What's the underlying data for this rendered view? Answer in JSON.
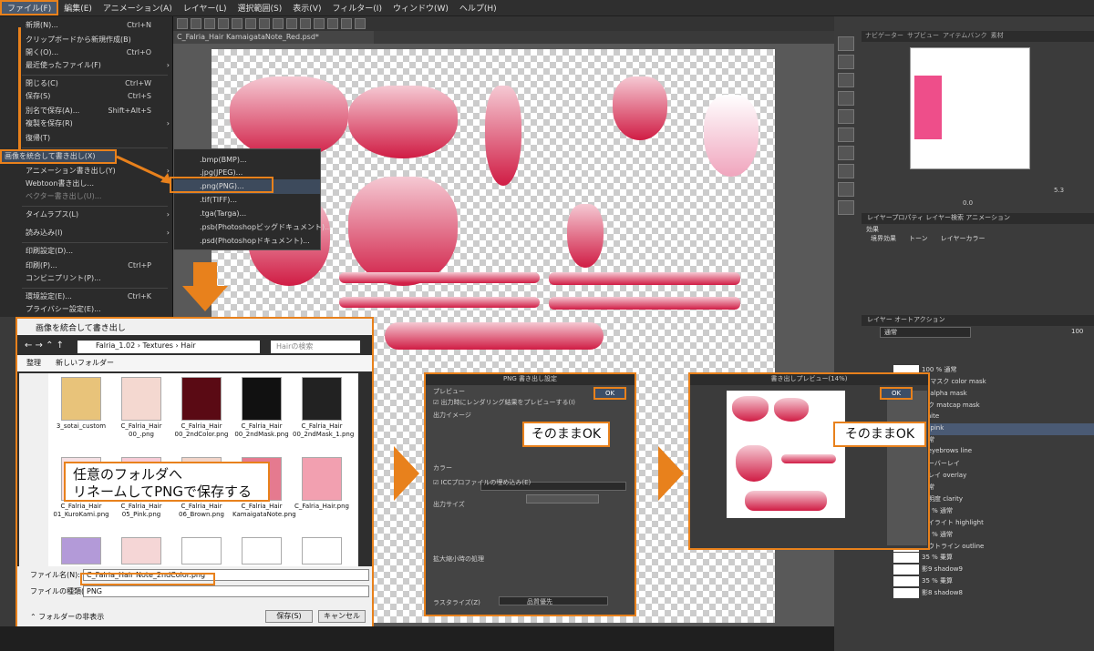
{
  "menubar": {
    "items": [
      "ファイル(F)",
      "編集(E)",
      "アニメーション(A)",
      "レイヤー(L)",
      "選択範囲(S)",
      "表示(V)",
      "フィルター(I)",
      "ウィンドウ(W)",
      "ヘルプ(H)"
    ]
  },
  "document": {
    "tab": "C_Falria_Hair KamaigataNote_Red.psd*"
  },
  "file_menu": {
    "items": [
      {
        "label": "新規(N)...",
        "shortcut": "Ctrl+N"
      },
      {
        "label": "クリップボードから新規作成(B)",
        "shortcut": ""
      },
      {
        "label": "開く(O)...",
        "shortcut": "Ctrl+O"
      },
      {
        "label": "最近使ったファイル(F)",
        "shortcut": ""
      },
      {
        "label": "閉じる(C)",
        "shortcut": "Ctrl+W"
      },
      {
        "label": "保存(S)",
        "shortcut": "Ctrl+S"
      },
      {
        "label": "別名で保存(A)...",
        "shortcut": "Shift+Alt+S"
      },
      {
        "label": "複製を保存(R)",
        "shortcut": ""
      },
      {
        "label": "復帰(T)",
        "shortcut": ""
      },
      {
        "label": "画像を統合して書き出し(X)",
        "shortcut": ""
      },
      {
        "label": "アニメーション書き出し(Y)",
        "shortcut": ""
      },
      {
        "label": "Webtoon書き出し...",
        "shortcut": ""
      },
      {
        "label": "ベクター書き出し(U)...",
        "shortcut": ""
      },
      {
        "label": "タイムラプス(L)",
        "shortcut": ""
      },
      {
        "label": "読み込み(I)",
        "shortcut": ""
      },
      {
        "label": "印刷設定(D)...",
        "shortcut": ""
      },
      {
        "label": "印刷(P)...",
        "shortcut": "Ctrl+P"
      },
      {
        "label": "コンビニプリント(P)...",
        "shortcut": ""
      },
      {
        "label": "環境設定(E)...",
        "shortcut": "Ctrl+K"
      },
      {
        "label": "プライバシー設定(E)...",
        "shortcut": ""
      }
    ]
  },
  "export_submenu": {
    "items": [
      ".bmp(BMP)...",
      ".jpg(JPEG)...",
      ".png(PNG)...",
      ".tif(TIFF)...",
      ".tga(Targa)...",
      ".psb(Photoshopビッグドキュメント)...",
      ".psd(Photoshopドキュメント)..."
    ]
  },
  "save_dialog": {
    "title": "画像を統合して書き出し",
    "path": [
      "Falria_1.02",
      "Textures",
      "Hair"
    ],
    "search_placeholder": "Hairの検索",
    "organize": "整理",
    "new_folder": "新しいフォルダー",
    "files": [
      "3_sotai_custom",
      "C_Falria_Hair 00_.png",
      "C_Falria_Hair 00_2ndColor.png",
      "C_Falria_Hair 00_2ndMask.png",
      "C_Falria_Hair 00_2ndMask_1.png",
      "C_Falria_Hair 01_KuroKami.png",
      "C_Falria_Hair 05_Pink.png",
      "C_Falria_Hair 06_Brown.png",
      "C_Falria_Hair KamaigataNote.png",
      "C_Falria_Hair.png"
    ],
    "filename_label": "ファイル名(N):",
    "filename_value": "C_Falria_Hair Note_2ndColor.png",
    "filetype_label": "ファイルの種類(T):",
    "filetype_value": "PNG",
    "hide_folders": "フォルダーの非表示",
    "save_btn": "保存(S)",
    "cancel_btn": "キャンセル"
  },
  "callout_1": {
    "line1": "任意のフォルダへ",
    "line2": "リネームしてPNGで保存する"
  },
  "png_dialog": {
    "title": "PNG 書き出し設定",
    "preview_section": "プレビュー",
    "preview_check": "出力時にレンダリング結果をプレビューする(I)",
    "output_image": "出力イメージ",
    "color": "カラー",
    "ok": "OK",
    "icc": "ICCプロファイルの埋め込み(E)",
    "output_size": "出力サイズ",
    "expand": "拡大縮小時の処理",
    "raster": "ラスタライズ(Z)",
    "preset": "品質優先"
  },
  "callout_2": "そのままOK",
  "preview_dialog": {
    "title": "書き出しプレビュー(14%)",
    "ok": "OK"
  },
  "callout_3": "そのままOK",
  "right_panel": {
    "nav_tabs": [
      "ナビゲーター",
      "サブビュー",
      "アイテムバンク",
      "素材"
    ],
    "zoom": "5.3",
    "rotate": "0.0",
    "prop_tabs": [
      "レイヤープロパティ",
      "レイヤー検索",
      "アニメーション"
    ],
    "effect": "効果",
    "border_effect": "境界効果",
    "tone": "トーン",
    "layer_color": "レイヤーカラー",
    "layer_tabs": [
      "レイヤー",
      "オートアクション"
    ],
    "blend": "通常",
    "opacity": "100",
    "layers": [
      {
        "name": "100 % 通常"
      },
      {
        "name": "色 マスク color mask"
      },
      {
        "name": "ク alpha mask"
      },
      {
        "name": "スク matcap mask"
      },
      {
        "name": "white"
      },
      {
        "name": "ar pink"
      },
      {
        "name": "通常"
      },
      {
        "name": "8 eyebrows line"
      },
      {
        "name": "オーバーレイ"
      },
      {
        "name": "ーレイ overlay"
      },
      {
        "name": "通常"
      },
      {
        "name": "透明度 clarity"
      },
      {
        "name": "55 % 通常"
      },
      {
        "name": "ハイライト highlight"
      },
      {
        "name": "88 % 通常"
      },
      {
        "name": "アウトライン outline"
      },
      {
        "name": "35 % 乗算"
      },
      {
        "name": "影9 shadow9"
      },
      {
        "name": "35 % 乗算"
      },
      {
        "name": "影8 shadow8"
      }
    ]
  },
  "colors": {
    "accent": "#e8811c",
    "hair": "#d01c44",
    "pink": "#ee4e8a"
  }
}
